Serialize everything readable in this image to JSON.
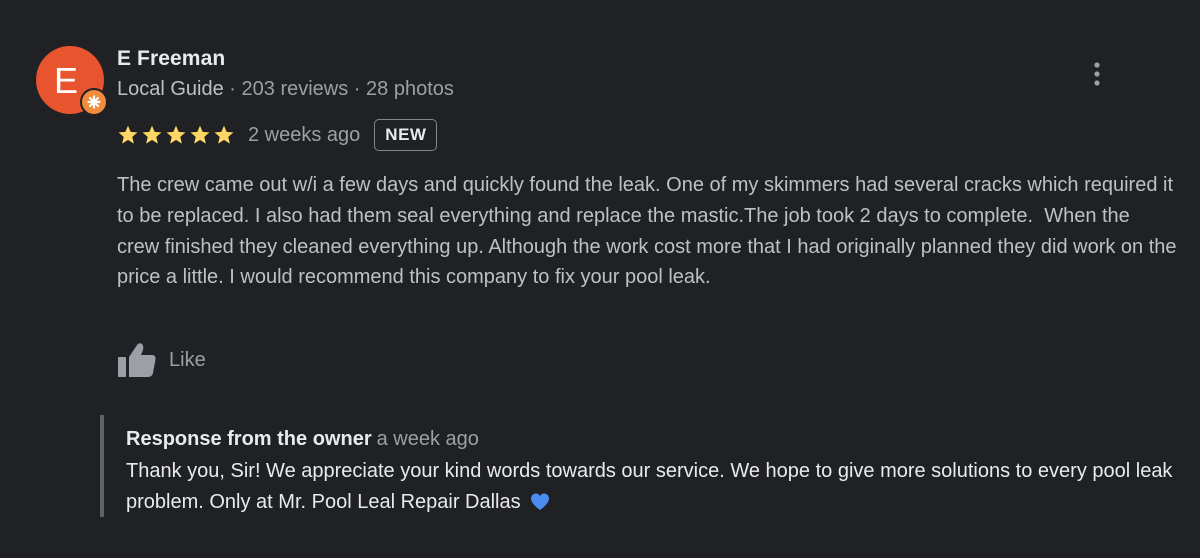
{
  "reviewer": {
    "initial": "E",
    "name": "E Freeman",
    "badge": "Local Guide",
    "separator": " · ",
    "reviews": "203 reviews",
    "photos": "28 photos",
    "avatar_color": "#e8542e"
  },
  "rating": {
    "stars": 5,
    "date": "2 weeks ago",
    "badge": "NEW",
    "star_color": "#fdd663"
  },
  "review": {
    "text": "The crew came out w/i a few days and quickly found the leak. One of my skimmers had several cracks which required it to be replaced. I also had them seal everything and replace the mastic.The job took 2 days to complete.  When the crew finished they cleaned everything up. Although the work cost more that I had originally planned they did work on the price a little. I would recommend this company to fix your pool leak."
  },
  "actions": {
    "like_label": "Like",
    "like_icon": "thumbs-up-icon",
    "more_icon": "more-vertical-icon"
  },
  "owner_response": {
    "title": "Response from the owner",
    "date": "a week ago",
    "text": "Thank you, Sir! We appreciate your kind words towards our service. We hope to give more solutions to every pool leak problem. Only at Mr. Pool Leal Repair Dallas",
    "emoji_icon": "blue-heart-icon",
    "heart_color": "#4a8cf0"
  }
}
